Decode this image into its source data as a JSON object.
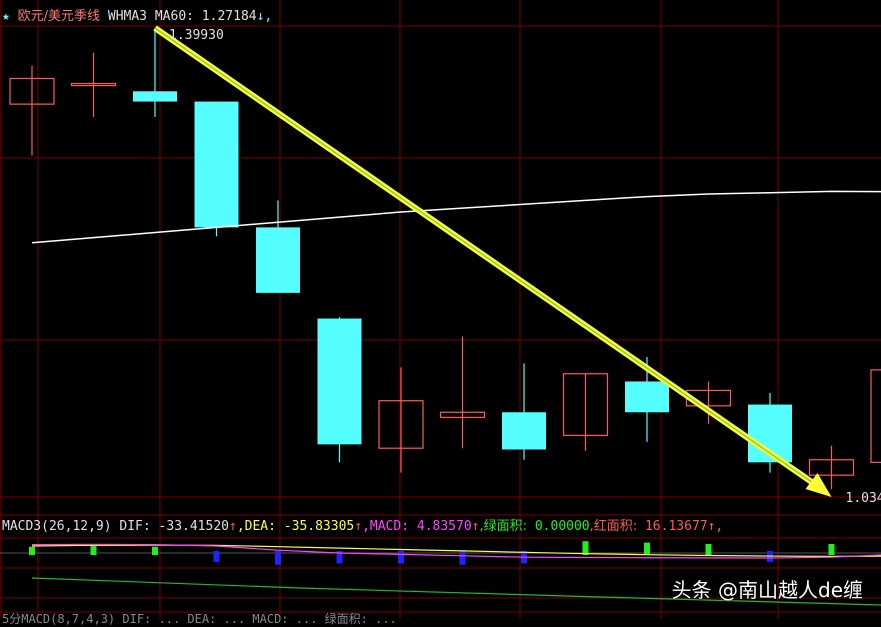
{
  "main_header": {
    "star": "★",
    "symbol": "欧元/美元季线",
    "indicator": "WHMA3",
    "ma_label": "MA60:",
    "ma_value": "1.27184",
    "ma_arrow": "↓,"
  },
  "price_labels": {
    "high": "1.39930",
    "low": "1.034"
  },
  "macd_header": {
    "name": "MACD3(26,12,9)",
    "dif_label": "DIF:",
    "dif_value": "-33.41520",
    "dif_arrow": "↑",
    "dea_label": ",DEA:",
    "dea_value": "-35.83305",
    "dea_arrow": "↑",
    "macd_label": ",MACD:",
    "macd_value": "4.83570",
    "macd_arrow": "↑",
    "green_label": ",绿面积:",
    "green_value": "0.00000",
    "red_label": ",红面积:",
    "red_value": "16.13677",
    "red_arrow": "↑,"
  },
  "third_header": "5分MACD(8,7,4,3) DIF: ... DEA: ... MACD: ... 绿面积: ...",
  "watermark": "头条 @南山越人de缠",
  "colors": {
    "background": "#000000",
    "bull": "#ff5a5a",
    "bear": "#55ffff",
    "ma": "#ffffff",
    "arrow": "#ffff33",
    "grid": "#7a0000",
    "macd_pos": "#22ee22",
    "macd_neg": "#2222ff",
    "dea": "#ffff44",
    "dif": "#ff44ff"
  },
  "chart_data": {
    "type": "candlestick",
    "ylim": [
      1.034,
      1.3993
    ],
    "candles": [
      {
        "o": 1.34,
        "h": 1.37,
        "l": 1.3,
        "c": 1.36
      },
      {
        "o": 1.355,
        "h": 1.38,
        "l": 1.33,
        "c": 1.356
      },
      {
        "o": 1.35,
        "h": 1.3993,
        "l": 1.33,
        "c": 1.342
      },
      {
        "o": 1.342,
        "h": 1.342,
        "l": 1.237,
        "c": 1.244
      },
      {
        "o": 1.244,
        "h": 1.265,
        "l": 1.2,
        "c": 1.193
      },
      {
        "o": 1.173,
        "h": 1.174,
        "l": 1.061,
        "c": 1.075
      },
      {
        "o": 1.072,
        "h": 1.135,
        "l": 1.053,
        "c": 1.109
      },
      {
        "o": 1.096,
        "h": 1.159,
        "l": 1.072,
        "c": 1.1
      },
      {
        "o": 1.1,
        "h": 1.138,
        "l": 1.063,
        "c": 1.071
      },
      {
        "o": 1.082,
        "h": 1.13,
        "l": 1.07,
        "c": 1.13
      },
      {
        "o": 1.124,
        "h": 1.143,
        "l": 1.077,
        "c": 1.1
      },
      {
        "o": 1.105,
        "h": 1.124,
        "l": 1.091,
        "c": 1.117
      },
      {
        "o": 1.106,
        "h": 1.115,
        "l": 1.053,
        "c": 1.061
      },
      {
        "o": 1.051,
        "h": 1.074,
        "l": 1.04,
        "c": 1.063
      },
      {
        "o": 1.061,
        "h": 1.15,
        "l": 1.04,
        "c": 1.133
      }
    ],
    "ma60": [
      1.232,
      1.236,
      1.24,
      1.244,
      1.248,
      1.252,
      1.256,
      1.259,
      1.262,
      1.265,
      1.268,
      1.27,
      1.271,
      1.272,
      1.27184
    ],
    "macd_hist": [
      0.3,
      0.35,
      0.3,
      -0.5,
      -0.7,
      -0.6,
      -0.6,
      -0.7,
      -0.6,
      0.7,
      0.6,
      0.5,
      -0.5,
      0.5,
      0.6
    ],
    "dif": [
      0.6,
      0.62,
      0.6,
      0.5,
      0.2,
      0.0,
      -0.1,
      -0.2,
      -0.3,
      -0.32,
      -0.34,
      -0.35,
      -0.36,
      -0.3,
      -0.1
    ],
    "dea": [
      0.5,
      0.55,
      0.56,
      0.55,
      0.45,
      0.35,
      0.25,
      0.15,
      0.05,
      -0.05,
      -0.12,
      -0.18,
      -0.22,
      -0.24,
      -0.22
    ]
  }
}
